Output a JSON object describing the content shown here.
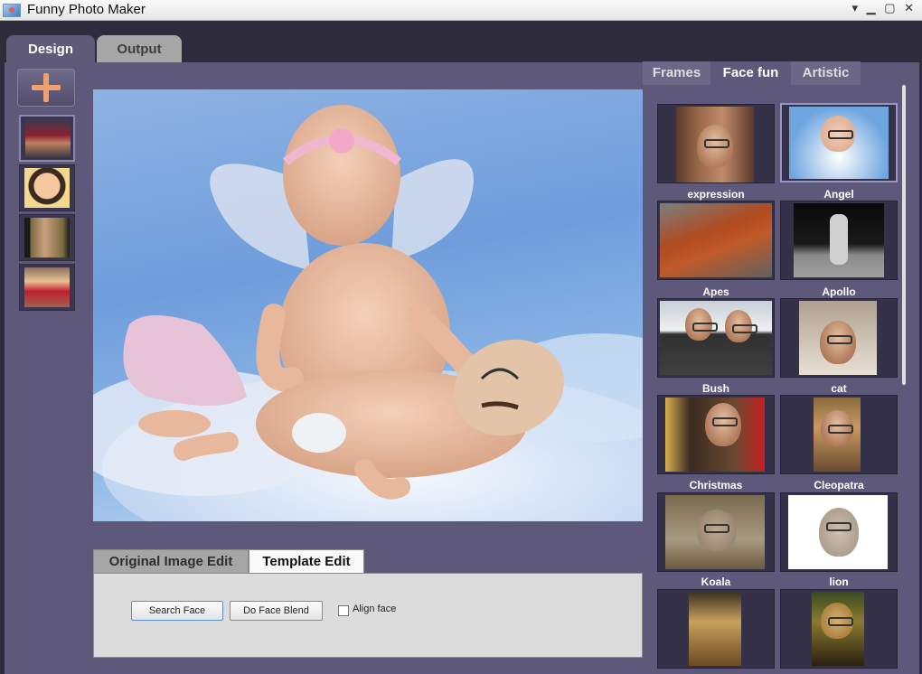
{
  "window": {
    "title": "Funny Photo Maker",
    "controls": "▾ ▁ ▢ ✕"
  },
  "main_tabs": [
    {
      "label": "Design"
    },
    {
      "label": "Output"
    }
  ],
  "right_tabs": [
    {
      "label": "Frames"
    },
    {
      "label": "Face fun"
    },
    {
      "label": "Artistic"
    }
  ],
  "edit_tabs": [
    {
      "label": "Original Image Edit"
    },
    {
      "label": "Template Edit"
    }
  ],
  "edit_panel": {
    "search_face": "Search Face",
    "face_blend": "Do Face Blend",
    "align_face": "Align face",
    "align_checked": false
  },
  "templates": [
    {
      "label": "expression"
    },
    {
      "label": "Angel"
    },
    {
      "label": "Apes"
    },
    {
      "label": "Apollo"
    },
    {
      "label": "Bush"
    },
    {
      "label": "cat"
    },
    {
      "label": "Christmas"
    },
    {
      "label": "Cleopatra"
    },
    {
      "label": "Koala"
    },
    {
      "label": "lion"
    },
    {
      "label": ""
    },
    {
      "label": ""
    }
  ],
  "selected_template": "Angel",
  "colors": {
    "accent": "#5e597a",
    "plus": "#f2a070"
  }
}
